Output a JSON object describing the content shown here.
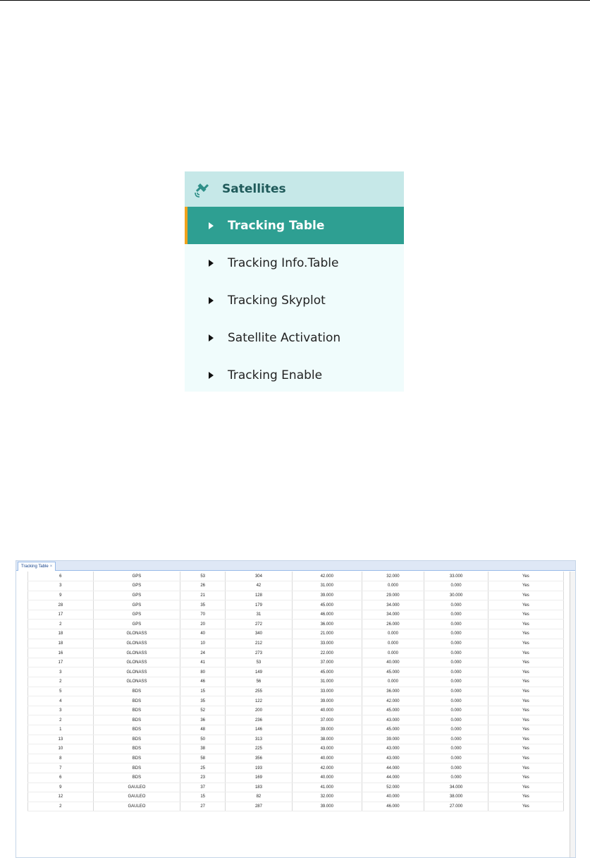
{
  "menu": {
    "title": "Satellites",
    "items": [
      {
        "label": "Tracking Table",
        "active": true
      },
      {
        "label": "Tracking Info.Table",
        "active": false
      },
      {
        "label": "Tracking Skyplot",
        "active": false
      },
      {
        "label": "Satellite Activation",
        "active": false
      },
      {
        "label": "Tracking Enable",
        "active": false
      }
    ]
  },
  "window": {
    "tab_label": "Tracking Table",
    "tab_close": "×"
  },
  "rows": [
    [
      "6",
      "GPS",
      "53",
      "304",
      "42.000",
      "32.000",
      "33.000",
      "Yes"
    ],
    [
      "3",
      "GPS",
      "26",
      "42",
      "31.000",
      "0.000",
      "0.000",
      "Yes"
    ],
    [
      "9",
      "GPS",
      "21",
      "128",
      "39.000",
      "29.000",
      "30.000",
      "Yes"
    ],
    [
      "28",
      "GPS",
      "35",
      "179",
      "45.000",
      "34.000",
      "0.000",
      "Yes"
    ],
    [
      "17",
      "GPS",
      "70",
      "31",
      "46.000",
      "34.000",
      "0.000",
      "Yes"
    ],
    [
      "2",
      "GPS",
      "20",
      "272",
      "36.000",
      "26.000",
      "0.000",
      "Yes"
    ],
    [
      "18",
      "GLONASS",
      "40",
      "340",
      "21.000",
      "0.000",
      "0.000",
      "Yes"
    ],
    [
      "18",
      "GLONASS",
      "10",
      "212",
      "33.000",
      "0.000",
      "0.000",
      "Yes"
    ],
    [
      "16",
      "GLONASS",
      "24",
      "273",
      "22.000",
      "0.000",
      "0.000",
      "Yes"
    ],
    [
      "17",
      "GLONASS",
      "41",
      "53",
      "37.000",
      "40.000",
      "0.000",
      "Yes"
    ],
    [
      "3",
      "GLONASS",
      "80",
      "149",
      "45.000",
      "45.000",
      "0.000",
      "Yes"
    ],
    [
      "2",
      "GLONASS",
      "46",
      "56",
      "31.000",
      "0.000",
      "0.000",
      "Yes"
    ],
    [
      "5",
      "BDS",
      "15",
      "255",
      "33.000",
      "36.000",
      "0.000",
      "Yes"
    ],
    [
      "4",
      "BDS",
      "35",
      "122",
      "39.000",
      "42.000",
      "0.000",
      "Yes"
    ],
    [
      "3",
      "BDS",
      "52",
      "200",
      "40.000",
      "45.000",
      "0.000",
      "Yes"
    ],
    [
      "2",
      "BDS",
      "36",
      "236",
      "37.000",
      "43.000",
      "0.000",
      "Yes"
    ],
    [
      "1",
      "BDS",
      "48",
      "146",
      "39.000",
      "45.000",
      "0.000",
      "Yes"
    ],
    [
      "13",
      "BDS",
      "50",
      "313",
      "38.000",
      "39.000",
      "0.000",
      "Yes"
    ],
    [
      "10",
      "BDS",
      "38",
      "225",
      "43.000",
      "43.000",
      "0.000",
      "Yes"
    ],
    [
      "8",
      "BDS",
      "58",
      "356",
      "40.000",
      "43.000",
      "0.000",
      "Yes"
    ],
    [
      "7",
      "BDS",
      "25",
      "193",
      "42.000",
      "44.000",
      "0.000",
      "Yes"
    ],
    [
      "6",
      "BDS",
      "23",
      "169",
      "40.000",
      "44.000",
      "0.000",
      "Yes"
    ],
    [
      "9",
      "GAULEO",
      "37",
      "183",
      "41.000",
      "52.000",
      "34.000",
      "Yes"
    ],
    [
      "12",
      "GAULEO",
      "15",
      "82",
      "32.000",
      "40.000",
      "38.000",
      "Yes"
    ],
    [
      "2",
      "GAULEO",
      "27",
      "287",
      "39.000",
      "46.000",
      "27.000",
      "Yes"
    ]
  ]
}
